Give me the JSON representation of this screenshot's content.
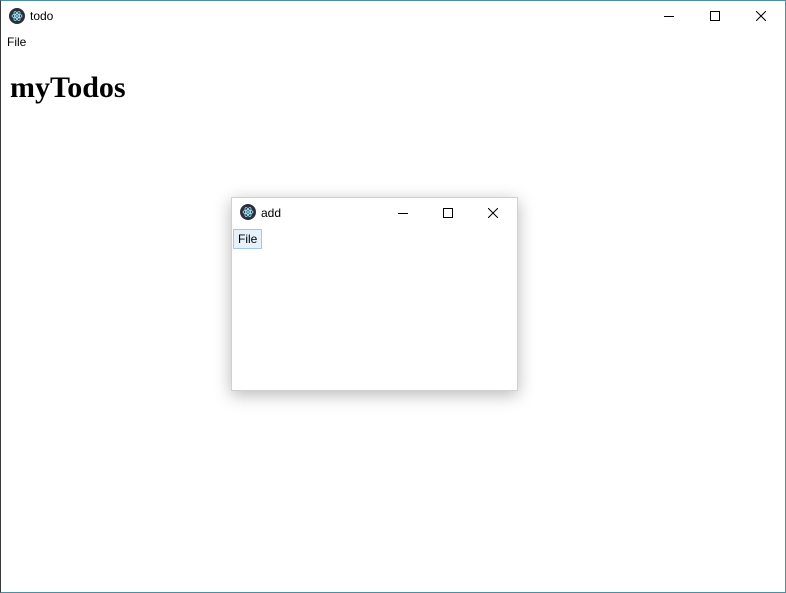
{
  "main_window": {
    "title": "todo",
    "menu": [
      "File"
    ],
    "heading": "myTodos",
    "controls": {
      "minimize": "minimize-icon",
      "maximize": "maximize-icon",
      "close": "close-icon"
    }
  },
  "dialog_window": {
    "title": "add",
    "menu": [
      "File"
    ],
    "controls": {
      "minimize": "minimize-icon",
      "maximize": "maximize-icon",
      "close": "close-icon"
    }
  },
  "colors": {
    "window_bg": "#ffffff",
    "icon_bg": "#2b2e3b",
    "menu_hover_bg": "#e5f1fb",
    "menu_hover_border": "#9ec8ef"
  }
}
